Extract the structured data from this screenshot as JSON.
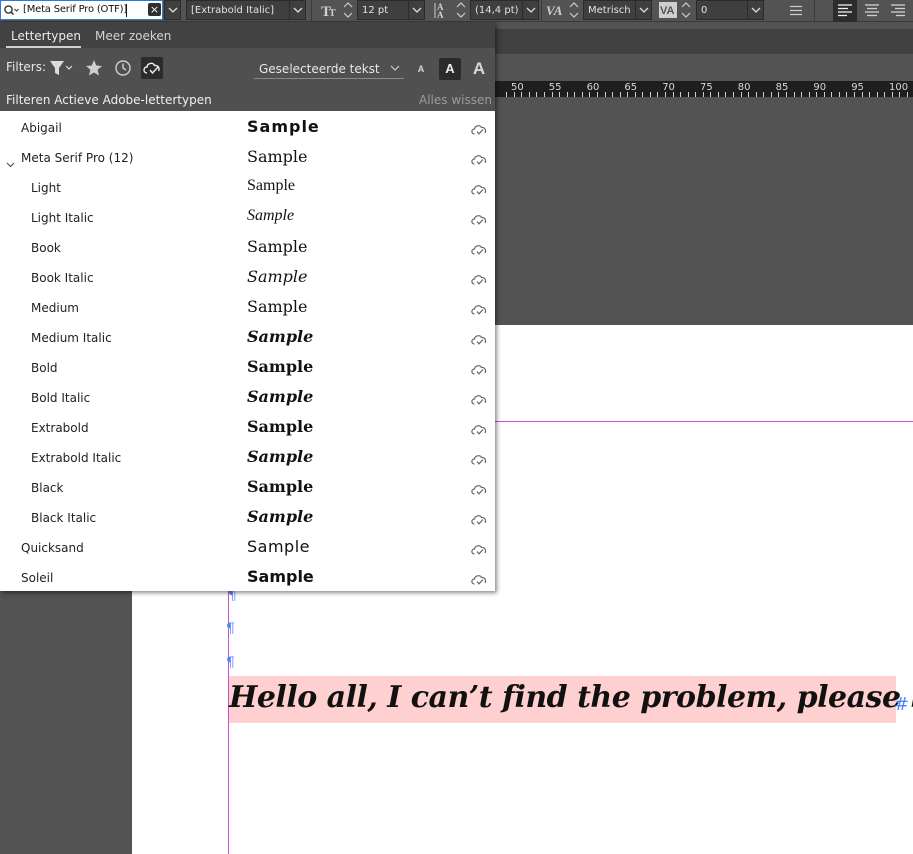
{
  "control_bar": {
    "font_family_value": "[Meta Serif Pro (OTF)]",
    "font_style_value": "[Extrabold Italic]",
    "font_size_value": "12 pt",
    "leading_value": "(14,4 pt)",
    "kerning_value": "Metrisch",
    "tracking_value": "0",
    "clear_glyph": "×"
  },
  "panel": {
    "tabs": [
      "Lettertypen",
      "Meer zoeken"
    ],
    "filters_label": "Filters:",
    "preview_select": "Geselecteerde tekst",
    "size_small": "A",
    "size_medium": "A",
    "size_large": "A",
    "filter_text": "Filteren Actieve Adobe-lettertypen",
    "clear_all": "Alles wissen",
    "sample_text": "Sample",
    "fonts": [
      {
        "name": "Abigail",
        "style": "abigail"
      },
      {
        "name": "Meta Serif Pro (12)",
        "style": "regular",
        "group": true
      },
      {
        "name": "Light",
        "style": "light"
      },
      {
        "name": "Light Italic",
        "style": "light-italic"
      },
      {
        "name": "Book",
        "style": "regular"
      },
      {
        "name": "Book Italic",
        "style": "italic"
      },
      {
        "name": "Medium",
        "style": "medium"
      },
      {
        "name": "Medium Italic",
        "style": "medium-italic"
      },
      {
        "name": "Bold",
        "style": "bold"
      },
      {
        "name": "Bold Italic",
        "style": "bold-italic"
      },
      {
        "name": "Extrabold",
        "style": "bold"
      },
      {
        "name": "Extrabold Italic",
        "style": "bold-italic"
      },
      {
        "name": "Black",
        "style": "black"
      },
      {
        "name": "Black Italic",
        "style": "black-italic"
      },
      {
        "name": "Quicksand",
        "style": "quicksand"
      },
      {
        "name": "Soleil",
        "style": "soleil"
      }
    ]
  },
  "ruler": {
    "labels": [
      "50",
      "55",
      "60",
      "65",
      "70",
      "75",
      "80",
      "85",
      "90",
      "95",
      "100"
    ]
  },
  "document": {
    "text": "Hello all, I can’t find the problem, please help",
    "end_marker": "#",
    "para_marker": "¶"
  },
  "colors": {
    "selection": "#ffd0d0",
    "guide": "#d24bd2",
    "hidden_chars": "#4f86ff"
  }
}
